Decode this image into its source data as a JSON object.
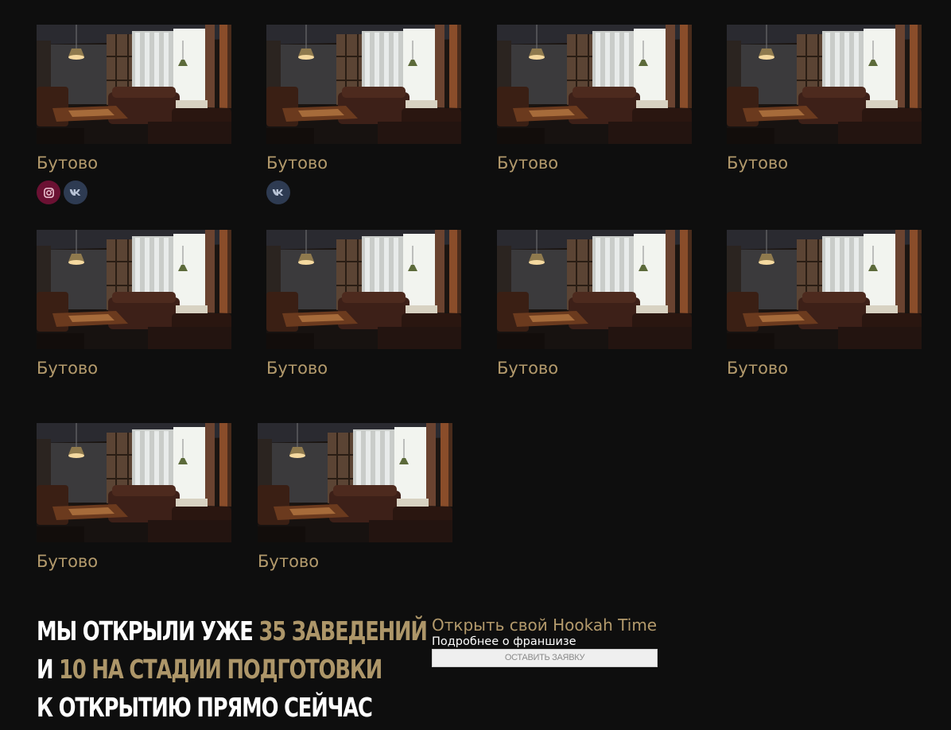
{
  "venues": [
    {
      "name": "Бутово",
      "social": [
        "instagram-icon",
        "vk-icon"
      ]
    },
    {
      "name": "Бутово",
      "social": [
        "vk-icon"
      ]
    },
    {
      "name": "Бутово",
      "social": []
    },
    {
      "name": "Бутово",
      "social": []
    },
    {
      "name": "Бутово",
      "social": []
    },
    {
      "name": "Бутово",
      "social": []
    },
    {
      "name": "Бутово",
      "social": []
    },
    {
      "name": "Бутово",
      "social": []
    },
    {
      "name": "Бутово",
      "social": []
    },
    {
      "name": "Бутово",
      "social": []
    }
  ],
  "promo": {
    "line1_a": "Мы открыли уже ",
    "line1_b": "35 заведений",
    "line2_a": "и ",
    "line2_b": "10 на стадии подготовки",
    "line3": "к открытию прямо сейчас"
  },
  "franchise": {
    "title": "Открыть свой Hookah Time",
    "subtitle": "Подробнее о франшизе",
    "button_label": "Оставить заявку"
  },
  "colors": {
    "background": "#0e0e0e",
    "accent": "#b39a6c",
    "instagram_bg": "#6b1133",
    "vk_bg": "#2e3b52"
  }
}
